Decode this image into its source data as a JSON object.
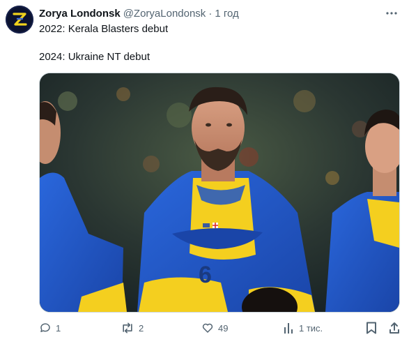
{
  "post": {
    "author_name": "Zorya Londonsk",
    "author_handle": "@ZoryaLondonsk",
    "separator": "·",
    "time": "1 год",
    "lines": [
      "2022: Kerala Blasters debut",
      "2024: Ukraine NT debut"
    ],
    "image_alt": "Players wrapped in Ukrainian flags"
  },
  "actions": {
    "replies": "1",
    "reposts": "2",
    "likes": "49",
    "views": "1 тис."
  },
  "colors": {
    "text": "#0f1419",
    "secondary": "#536471",
    "flag_blue": "#1e56c8",
    "flag_yellow": "#f4cf1f",
    "avatar_bg": "#0b1230",
    "avatar_accent": "#f0d21c"
  }
}
